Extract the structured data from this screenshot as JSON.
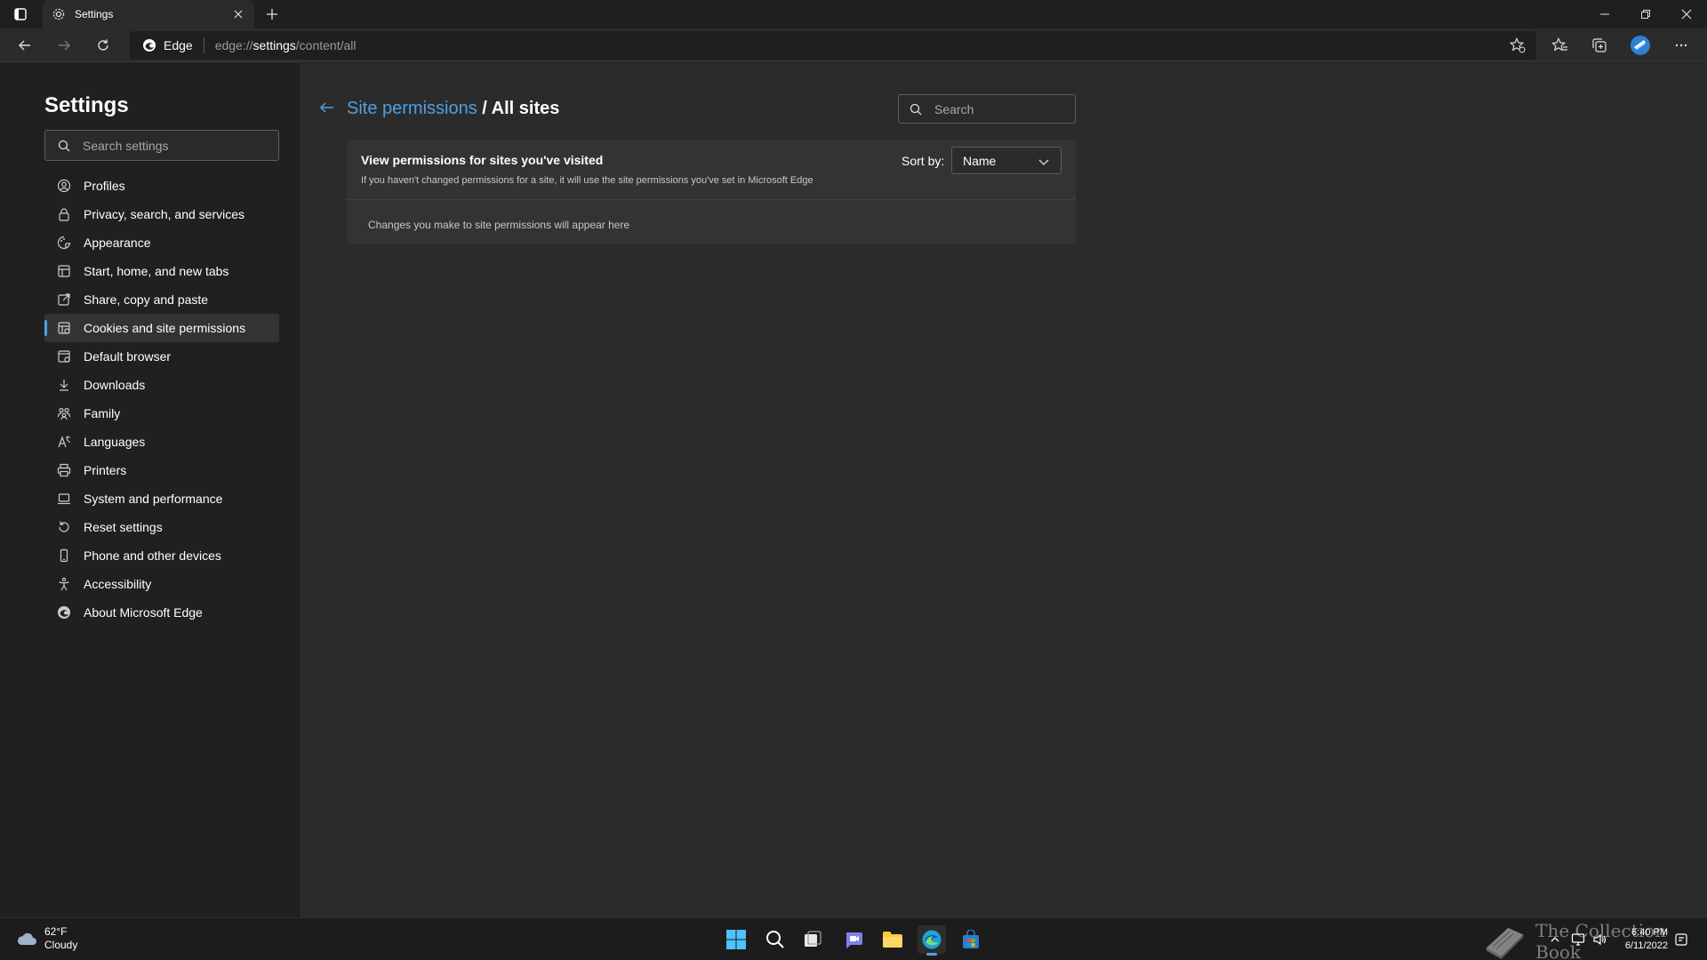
{
  "browser": {
    "tab": {
      "title": "Settings"
    },
    "address": {
      "badge": "Edge",
      "url_prefix": "edge://",
      "url_bold": "settings",
      "url_suffix": "/content/all"
    }
  },
  "sidebar": {
    "title": "Settings",
    "search_placeholder": "Search settings",
    "items": [
      {
        "label": "Profiles",
        "icon": "profile-icon"
      },
      {
        "label": "Privacy, search, and services",
        "icon": "lock-icon"
      },
      {
        "label": "Appearance",
        "icon": "appearance-icon"
      },
      {
        "label": "Start, home, and new tabs",
        "icon": "home-tabs-icon"
      },
      {
        "label": "Share, copy and paste",
        "icon": "share-icon"
      },
      {
        "label": "Cookies and site permissions",
        "icon": "cookies-icon",
        "active": true
      },
      {
        "label": "Default browser",
        "icon": "default-browser-icon"
      },
      {
        "label": "Downloads",
        "icon": "download-icon"
      },
      {
        "label": "Family",
        "icon": "family-icon"
      },
      {
        "label": "Languages",
        "icon": "languages-icon"
      },
      {
        "label": "Printers",
        "icon": "printer-icon"
      },
      {
        "label": "System and performance",
        "icon": "laptop-icon"
      },
      {
        "label": "Reset settings",
        "icon": "reset-icon"
      },
      {
        "label": "Phone and other devices",
        "icon": "phone-icon"
      },
      {
        "label": "Accessibility",
        "icon": "accessibility-icon"
      },
      {
        "label": "About Microsoft Edge",
        "icon": "edge-logo-icon"
      }
    ]
  },
  "main": {
    "breadcrumb_link": "Site permissions",
    "breadcrumb_sep": " / ",
    "breadcrumb_current": "All sites",
    "search_placeholder": "Search",
    "card": {
      "title": "View permissions for sites you've visited",
      "subtitle": "If you haven't changed permissions for a site, it will use the site permissions you've set in Microsoft Edge",
      "sort_label": "Sort by:",
      "sort_value": "Name",
      "empty_text": "Changes you make to site permissions will appear here"
    }
  },
  "taskbar": {
    "weather_temp": "62°F",
    "weather_desc": "Cloudy",
    "time": "6:40 PM",
    "date": "6/11/2022",
    "watermark": "The Collection Book"
  },
  "colors": {
    "accent": "#4ca0e6",
    "sidebar_bg": "#202020",
    "main_bg": "#2b2b2b",
    "card_bg": "#333333"
  }
}
